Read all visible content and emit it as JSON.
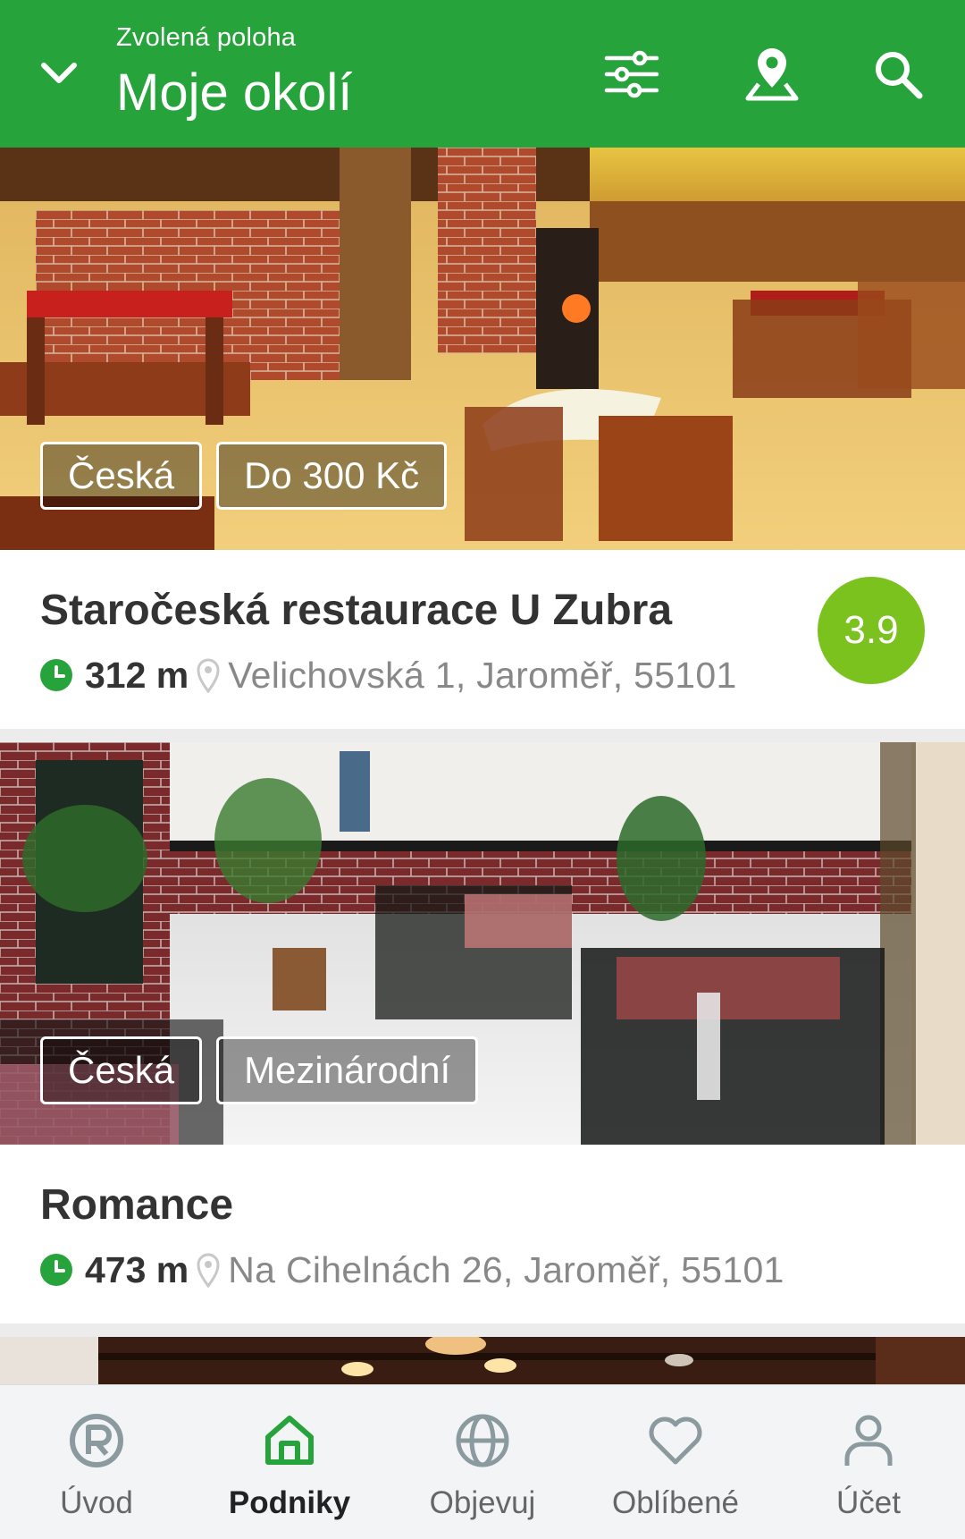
{
  "header": {
    "subtitle": "Zvolená poloha",
    "title": "Moje okolí",
    "icons": [
      "chevron-down-icon",
      "filter-sliders-icon",
      "map-location-icon",
      "search-icon"
    ],
    "color": "#27a33b"
  },
  "restaurants": [
    {
      "tags": [
        "Česká",
        "Do 300 Kč"
      ],
      "name": "Staročeská restaurace U Zubra",
      "distance": "312 m",
      "address": "Velichovská 1, Jaroměř, 55101",
      "rating": "3.9"
    },
    {
      "tags": [
        "Česká",
        "Mezinárodní"
      ],
      "name": "Romance",
      "distance": "473 m",
      "address": "Na Cihelnách 26, Jaroměř, 55101"
    }
  ],
  "colors": {
    "rating": "#7cc21e",
    "open_clock": "#27a33b",
    "nav_active": "#27a33b"
  },
  "bottom_nav": {
    "active": "Podniky",
    "items": [
      {
        "label": "Úvod",
        "icon": "r-logo-icon"
      },
      {
        "label": "Podniky",
        "icon": "home-icon"
      },
      {
        "label": "Objevuj",
        "icon": "globe-icon"
      },
      {
        "label": "Oblíbené",
        "icon": "heart-icon"
      },
      {
        "label": "Účet",
        "icon": "user-icon"
      }
    ]
  }
}
